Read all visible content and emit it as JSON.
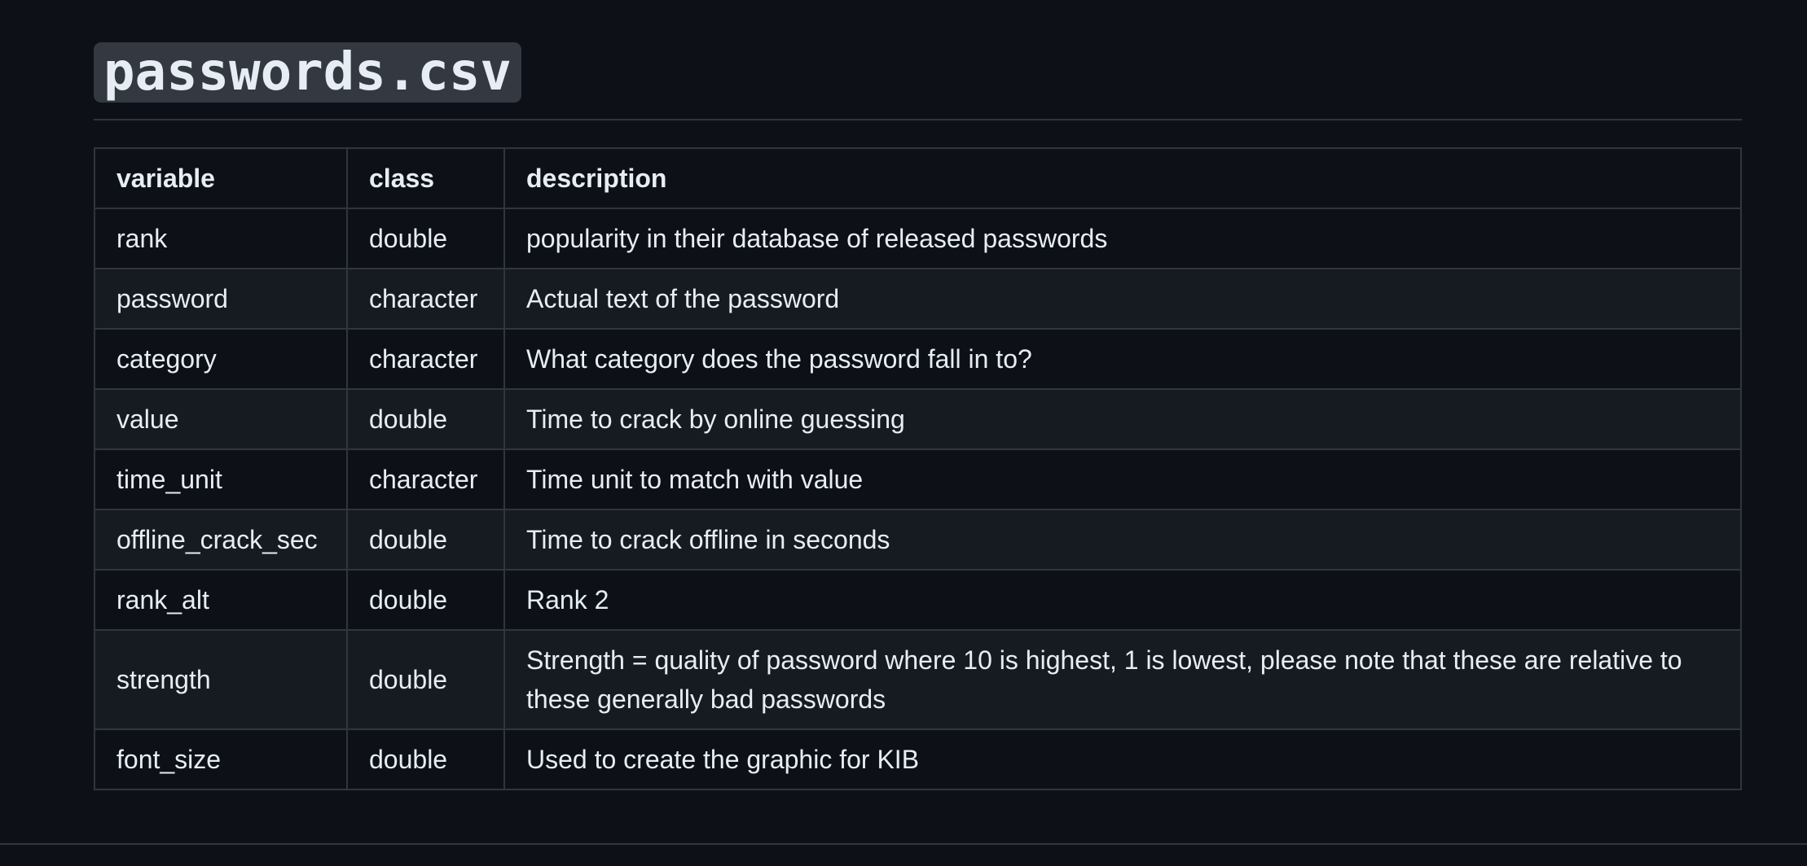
{
  "heading": {
    "title": "passwords.csv"
  },
  "table": {
    "headers": [
      "variable",
      "class",
      "description"
    ],
    "rows": [
      [
        "rank",
        "double",
        "popularity in their database of released passwords"
      ],
      [
        "password",
        "character",
        "Actual text of the password"
      ],
      [
        "category",
        "character",
        "What category does the password fall in to?"
      ],
      [
        "value",
        "double",
        "Time to crack by online guessing"
      ],
      [
        "time_unit",
        "character",
        "Time unit to match with value"
      ],
      [
        "offline_crack_sec",
        "double",
        "Time to crack offline in seconds"
      ],
      [
        "rank_alt",
        "double",
        "Rank 2"
      ],
      [
        "strength",
        "double",
        "Strength = quality of password where 10 is highest, 1 is lowest, please note that these are relative to these generally bad passwords"
      ],
      [
        "font_size",
        "double",
        "Used to create the graphic for KIB"
      ]
    ]
  }
}
